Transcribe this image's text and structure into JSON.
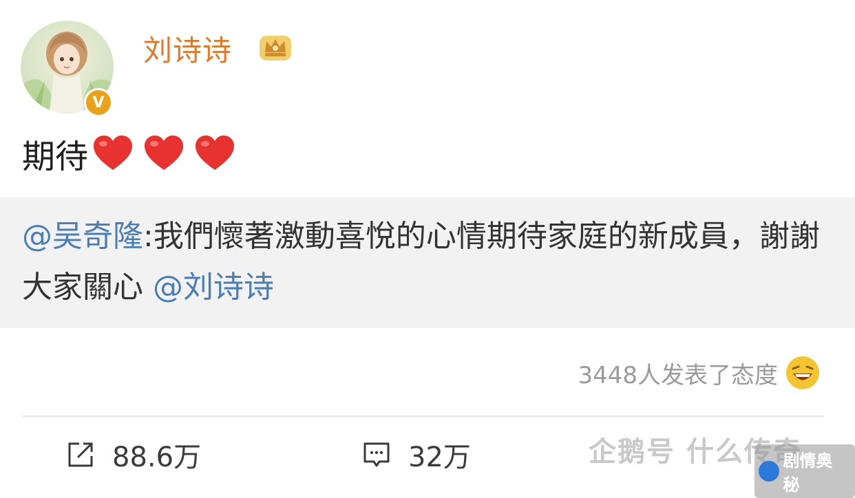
{
  "author": {
    "name": "刘诗诗",
    "verified_symbol": "V",
    "avatar_icon": "avatar-illustration",
    "badge_icon": "crown-icon"
  },
  "post": {
    "text": "期待",
    "emoji": [
      "heart-icon",
      "heart-icon",
      "heart-icon"
    ]
  },
  "quote": {
    "mention": "@吴奇隆",
    "colon": ":",
    "body": "我們懷著激動喜悅的心情期待家庭的新成員，謝謝大家關心 ",
    "trailing_mention": "@刘诗诗"
  },
  "reactions": {
    "text": "3448人发表了态度",
    "icon": "laughing-emoji-icon"
  },
  "actions": {
    "repost_count": "88.6万",
    "comment_count": "32万"
  },
  "watermark": {
    "text": "企鹅号 什么传奇",
    "badge_label": "剧情奥秘"
  },
  "colors": {
    "username": "#e07a2a",
    "mention": "#4a7fb5",
    "quote_bg": "#f2f2f2",
    "heart": "#e8322f"
  }
}
